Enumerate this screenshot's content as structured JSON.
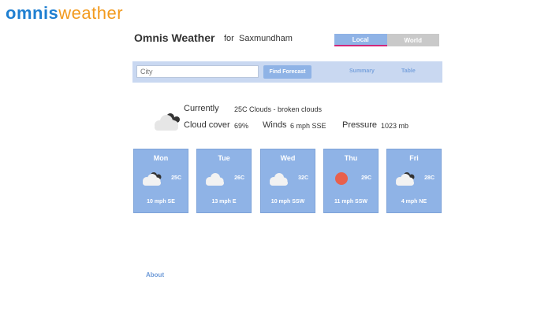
{
  "logo": {
    "omnis": "omnis",
    "weather": "weather"
  },
  "header": {
    "title": "Omnis Weather",
    "for_label": "for",
    "location": "Saxmundham"
  },
  "mode_toggle": {
    "local": "Local",
    "world": "World",
    "selected": "Local"
  },
  "search": {
    "city_placeholder": "City",
    "find_button": "Find Forecast",
    "tab_summary": "Summary",
    "tab_table": "Table"
  },
  "current": {
    "label": "Currently",
    "description": "25C Clouds - broken clouds",
    "cloud_cover_label": "Cloud cover",
    "cloud_cover_value": "69%",
    "winds_label": "Winds",
    "winds_value": "6 mph SSE",
    "pressure_label": "Pressure",
    "pressure_value": "1023 mb",
    "icon": "broken-clouds-icon"
  },
  "forecast": [
    {
      "day": "Mon",
      "temp": "25C",
      "wind": "10 mph SE",
      "icon": "broken-clouds-icon"
    },
    {
      "day": "Tue",
      "temp": "26C",
      "wind": "13 mph E",
      "icon": "cloud-icon"
    },
    {
      "day": "Wed",
      "temp": "32C",
      "wind": "10 mph SSW",
      "icon": "cloud-icon"
    },
    {
      "day": "Thu",
      "temp": "29C",
      "wind": "11 mph SSW",
      "icon": "sun-icon"
    },
    {
      "day": "Fri",
      "temp": "28C",
      "wind": "4 mph NE",
      "icon": "broken-clouds-icon"
    }
  ],
  "footer": {
    "about": "About"
  },
  "colors": {
    "brand_blue": "#1f7fd1",
    "brand_orange": "#f29a1e",
    "card_blue": "#8fb3e6",
    "search_bg": "#c9d8f1",
    "sun_red": "#e8604c",
    "toggle_underline": "#d0287a"
  }
}
